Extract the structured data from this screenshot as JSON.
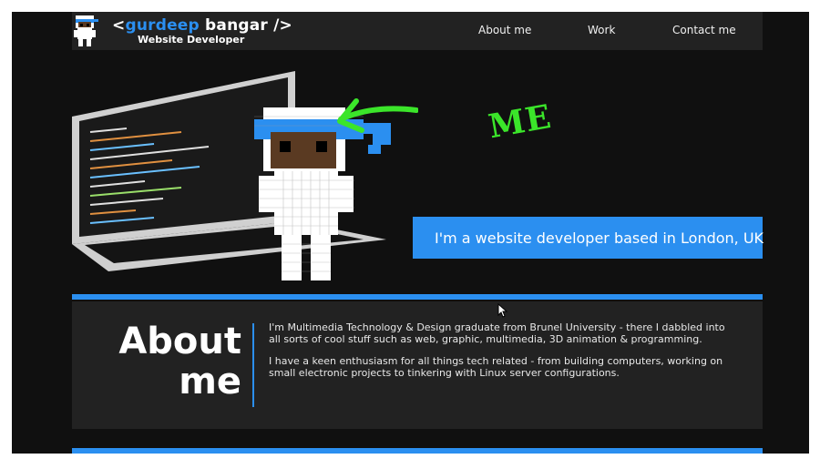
{
  "header": {
    "brand_open": "<",
    "brand_first": "gurdeep",
    "brand_last": " bangar",
    "brand_close": "/>",
    "tagline": "Website Developer",
    "nav": [
      {
        "label": "About me"
      },
      {
        "label": "Work"
      },
      {
        "label": "Contact me"
      }
    ]
  },
  "hero": {
    "me_label": "ME",
    "banner_text": "I'm a website developer based in London, UK"
  },
  "about": {
    "title_line1": "About",
    "title_line2": "me",
    "paragraph1": "I'm Multimedia Technology & Design graduate from Brunel University - there I dabbled into all sorts of cool stuff such as web, graphic, multimedia, 3D animation & programming.",
    "paragraph2": "I have a keen enthusiasm for all things tech related - from building computers, working on small electronic projects to tinkering with Linux server configurations."
  },
  "colors": {
    "accent": "#2b8ff0",
    "background": "#101010",
    "panel": "#222222",
    "me_green": "#3be52a"
  }
}
